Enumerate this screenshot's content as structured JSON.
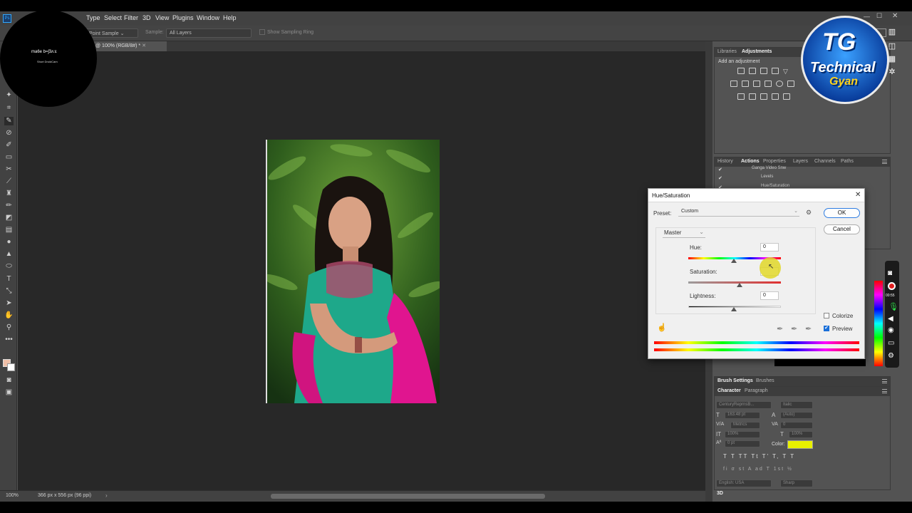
{
  "menu": [
    "Type",
    "Select",
    "Filter",
    "3D",
    "View",
    "Plugins",
    "Window",
    "Help"
  ],
  "options": {
    "sample_size": "Point Sample",
    "sample_label": "Sample:",
    "sample_value": "All Layers",
    "show_ring": "Show Sampling Ring"
  },
  "document_tab": "@ 100% (RGB/8#) *",
  "status": {
    "zoom": "100%",
    "doc_info": "366 px x 556 px (96 ppi)"
  },
  "watermark": {
    "line1": "ma6e b=ʃ3ʌ:ɛ",
    "line2": "Short DroidCam"
  },
  "logo": {
    "initials": "TG",
    "line1": "Technical",
    "line2": "Gyan"
  },
  "libraries_panel": {
    "tabs": [
      "Libraries",
      "Adjustments"
    ],
    "active": "Adjustments",
    "add_label": "Add an adjustment"
  },
  "actions_panel": {
    "tabs": [
      "History",
      "Actions",
      "Properties",
      "Layers",
      "Channels",
      "Paths"
    ],
    "active": "Actions",
    "items": [
      "Ganga Video Snw",
      "Levels",
      "Hue/Saturation"
    ]
  },
  "brush_panel": {
    "tabs": [
      "Brush Settings",
      "Brushes"
    ]
  },
  "character_panel": {
    "tabs": [
      "Character",
      "Paragraph"
    ],
    "font_family": "CenturyReprnsB...",
    "font_style": "Italic",
    "size": "163.48 pt",
    "leading": "(Auto)",
    "kerning": "Metrics",
    "tracking": "0",
    "vscale": "100%",
    "hscale": "100%",
    "baseline": "0 pt",
    "color_label": "Color:",
    "language": "English: USA",
    "aa": "Sharp",
    "glyphs": [
      "T",
      "T",
      "TT",
      "Tt",
      "T'",
      "T,",
      "T",
      "T"
    ],
    "glyphs2": [
      "fi",
      "σ",
      "st",
      "A",
      "ad",
      "T",
      "1st",
      "½"
    ],
    "swatch": "#e8f000"
  },
  "dialog": {
    "title": "Hue/Saturation",
    "preset_label": "Preset:",
    "preset_value": "Custom",
    "ok": "OK",
    "cancel": "Cancel",
    "channel": "Master",
    "hue_label": "Hue:",
    "hue_value": "0",
    "sat_label": "Saturation:",
    "sat_value": "",
    "light_label": "Lightness:",
    "light_value": "0",
    "colorize": "Colorize",
    "preview": "Preview",
    "colorize_checked": false,
    "preview_checked": true
  },
  "panel_labels": {
    "threed": "3D"
  },
  "time_readout": "00:55"
}
